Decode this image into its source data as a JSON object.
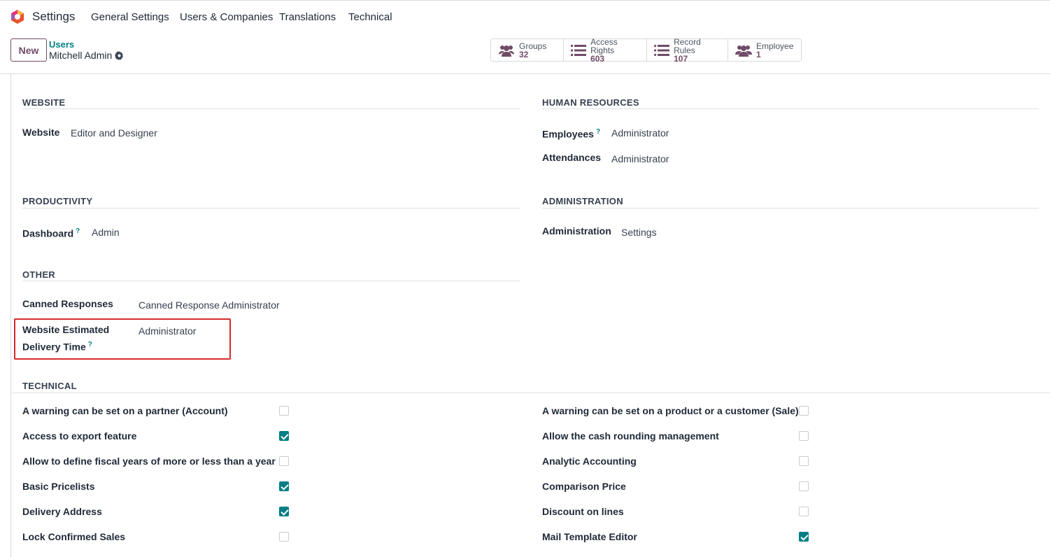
{
  "app": {
    "name": "Settings"
  },
  "nav": [
    "General Settings",
    "Users & Companies",
    "Translations",
    "Technical"
  ],
  "control": {
    "new_label": "New",
    "breadcrumb_parent": "Users",
    "breadcrumb_current": "Mitchell Admin",
    "smart_buttons": [
      {
        "label": "Groups",
        "value": "32",
        "icon": "users-icon"
      },
      {
        "label": "Access Rights",
        "value": "603",
        "icon": "list-icon"
      },
      {
        "label": "Record Rules",
        "value": "107",
        "icon": "list-icon"
      },
      {
        "label": "Employee",
        "value": "1",
        "icon": "users-icon"
      }
    ]
  },
  "sections": {
    "website": {
      "title": "WEBSITE",
      "fields": [
        {
          "label": "Website",
          "value": "Editor and Designer"
        }
      ]
    },
    "hr": {
      "title": "HUMAN RESOURCES",
      "fields": [
        {
          "label": "Employees",
          "value": "Administrator",
          "help": "?"
        },
        {
          "label": "Attendances",
          "value": "Administrator"
        }
      ]
    },
    "productivity": {
      "title": "PRODUCTIVITY",
      "fields": [
        {
          "label": "Dashboard",
          "value": "Admin",
          "help": "?"
        }
      ]
    },
    "administration": {
      "title": "ADMINISTRATION",
      "fields": [
        {
          "label": "Administration",
          "value": "Settings"
        }
      ]
    },
    "other": {
      "title": "OTHER",
      "fields": [
        {
          "label": "Canned Responses",
          "value": "Canned Response Administrator"
        },
        {
          "label_line1": "Website Estimated",
          "label_line2": "Delivery Time",
          "value": "Administrator",
          "help": "?"
        }
      ]
    },
    "technical": {
      "title": "TECHNICAL",
      "left": [
        {
          "label": "A warning can be set on a partner (Account)",
          "checked": false
        },
        {
          "label": "Access to export feature",
          "checked": true
        },
        {
          "label": "Allow to define fiscal years of more or less than a year",
          "checked": false
        },
        {
          "label": "Basic Pricelists",
          "checked": true
        },
        {
          "label": "Delivery Address",
          "checked": true
        },
        {
          "label": "Lock Confirmed Sales",
          "checked": false
        }
      ],
      "right": [
        {
          "label": "A warning can be set on a product or a customer (Sale)",
          "checked": false
        },
        {
          "label": "Allow the cash rounding management",
          "checked": false
        },
        {
          "label": "Analytic Accounting",
          "checked": false
        },
        {
          "label": "Comparison Price",
          "checked": false
        },
        {
          "label": "Discount on lines",
          "checked": false
        },
        {
          "label": "Mail Template Editor",
          "checked": true
        }
      ]
    }
  },
  "colors": {
    "brand": "#714b67",
    "accent": "#017e84",
    "highlight": "#d62c2c"
  }
}
